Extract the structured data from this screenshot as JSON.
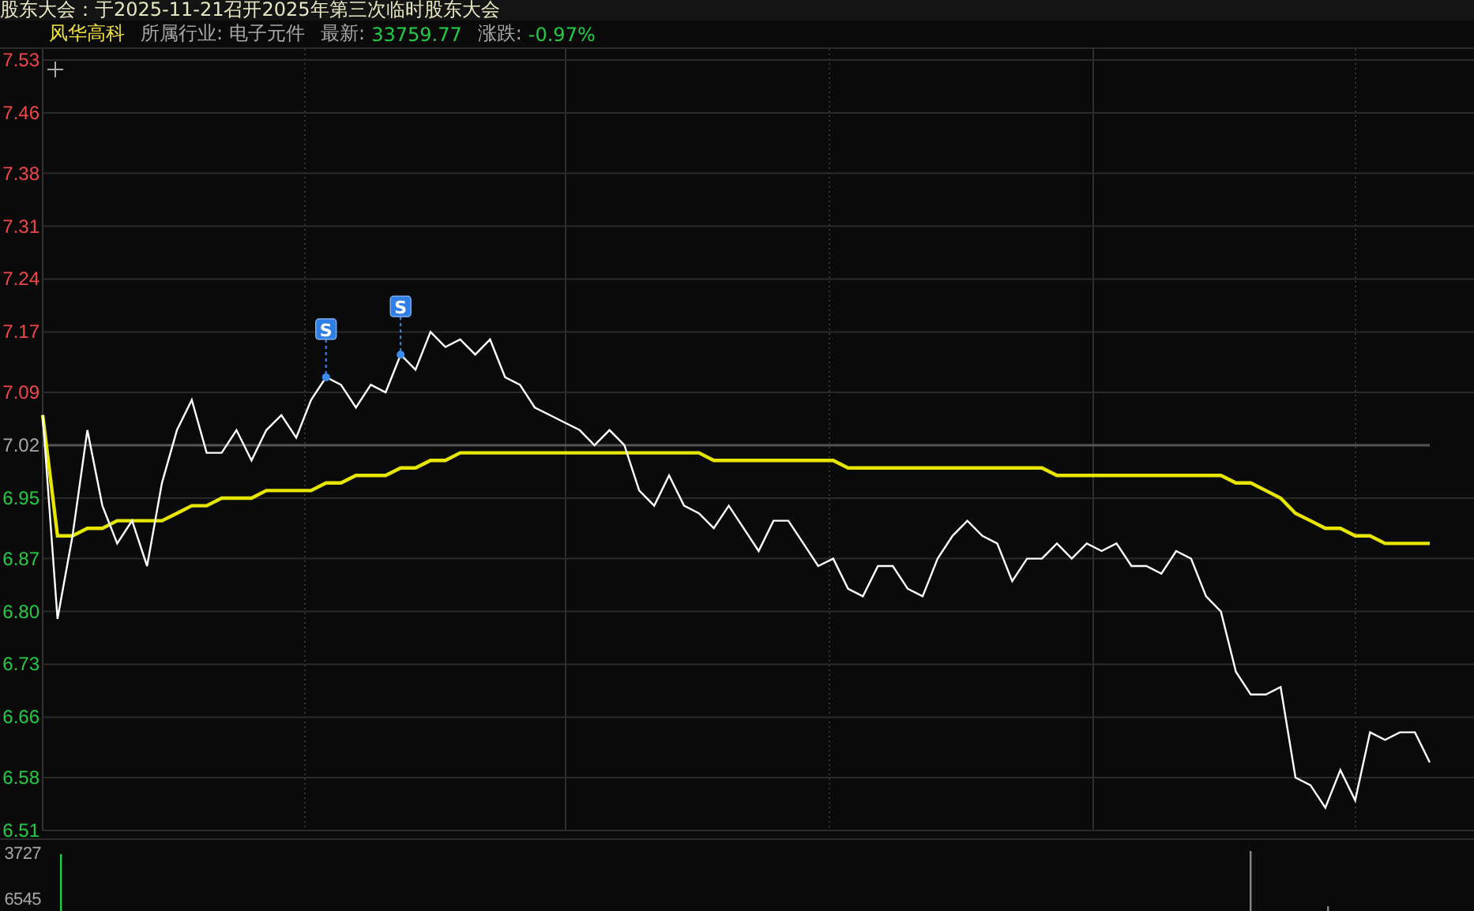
{
  "notice": "股东大会：于2025-11-21召开2025年第三次临时股东大会",
  "info_bar": {
    "name": "风华高科",
    "industry_label": "所属行业:",
    "industry": "电子元件",
    "latest_label": "最新:",
    "latest": "33759.77",
    "change_label": "涨跌:",
    "change": "-0.97%"
  },
  "price_chart": {
    "chart_data": {
      "type": "line",
      "grid": true,
      "ref_lines": [
        {
          "axis": "y",
          "value": 7.02,
          "color": "#555555"
        }
      ],
      "ylim": [
        6.51,
        7.53
      ],
      "yticks": [
        {
          "value": 7.53,
          "label": "7.53"
        },
        {
          "value": 7.46,
          "label": "7.46"
        },
        {
          "value": 7.38,
          "label": "7.38"
        },
        {
          "value": 7.31,
          "label": "7.31"
        },
        {
          "value": 7.24,
          "label": "7.24"
        },
        {
          "value": 7.17,
          "label": "7.17"
        },
        {
          "value": 7.09,
          "label": "7.09"
        },
        {
          "value": 7.02,
          "label": "7.02"
        },
        {
          "value": 6.95,
          "label": "6.95"
        },
        {
          "value": 6.87,
          "label": "6.87"
        },
        {
          "value": 6.8,
          "label": "6.80"
        },
        {
          "value": 6.73,
          "label": "6.73"
        },
        {
          "value": 6.66,
          "label": "6.66"
        },
        {
          "value": 6.58,
          "label": "6.58"
        },
        {
          "value": 6.51,
          "label": "6.51"
        }
      ],
      "categories": [
        null,
        null,
        null,
        null,
        null,
        null,
        null,
        null,
        null,
        null,
        null,
        null,
        null,
        null,
        null,
        null,
        null,
        null,
        null,
        null,
        null,
        null,
        null,
        null,
        null,
        null,
        null,
        null,
        null,
        null,
        null,
        null,
        null,
        null,
        null,
        null,
        null,
        null,
        null,
        null,
        null,
        null,
        null,
        null,
        null,
        null,
        null,
        null,
        null,
        null,
        null,
        null,
        null,
        null,
        null,
        null,
        null,
        null,
        null,
        null,
        null,
        null,
        null,
        null,
        null,
        null,
        null,
        null,
        null,
        null,
        null,
        null,
        null,
        null,
        null,
        null,
        null,
        null,
        null,
        null,
        null,
        null,
        null,
        null,
        null,
        null,
        null,
        null,
        null,
        null,
        null,
        null,
        null,
        null
      ],
      "series": [
        {
          "color": "#ffffff",
          "values": [
            7.06,
            6.79,
            6.9,
            7.04,
            6.94,
            6.89,
            6.92,
            6.86,
            6.97,
            7.04,
            7.08,
            7.01,
            7.01,
            7.04,
            7.0,
            7.04,
            7.06,
            7.03,
            7.08,
            7.11,
            7.1,
            7.07,
            7.1,
            7.09,
            7.14,
            7.12,
            7.17,
            7.15,
            7.16,
            7.14,
            7.16,
            7.11,
            7.1,
            7.07,
            7.06,
            7.05,
            7.04,
            7.02,
            7.04,
            7.02,
            6.96,
            6.94,
            6.98,
            6.94,
            6.93,
            6.91,
            6.94,
            6.91,
            6.88,
            6.92,
            6.92,
            6.89,
            6.86,
            6.87,
            6.83,
            6.82,
            6.86,
            6.86,
            6.83,
            6.82,
            6.87,
            6.9,
            6.92,
            6.9,
            6.89,
            6.84,
            6.87,
            6.87,
            6.89,
            6.87,
            6.89,
            6.88,
            6.89,
            6.86,
            6.86,
            6.85,
            6.88,
            6.87,
            6.82,
            6.8,
            6.72,
            6.69,
            6.69,
            6.7,
            6.58,
            6.57,
            6.54,
            6.59,
            6.55,
            6.64,
            6.63,
            6.64,
            6.64,
            6.6
          ]
        },
        {
          "color": "#e6e600",
          "values": [
            7.06,
            6.9,
            6.9,
            6.91,
            6.91,
            6.92,
            6.92,
            6.92,
            6.92,
            6.93,
            6.94,
            6.94,
            6.95,
            6.95,
            6.95,
            6.96,
            6.96,
            6.96,
            6.96,
            6.97,
            6.97,
            6.98,
            6.98,
            6.98,
            6.99,
            6.99,
            7.0,
            7.0,
            7.01,
            7.01,
            7.01,
            7.01,
            7.01,
            7.01,
            7.01,
            7.01,
            7.01,
            7.01,
            7.01,
            7.01,
            7.01,
            7.01,
            7.01,
            7.01,
            7.01,
            7.0,
            7.0,
            7.0,
            7.0,
            7.0,
            7.0,
            7.0,
            7.0,
            7.0,
            6.99,
            6.99,
            6.99,
            6.99,
            6.99,
            6.99,
            6.99,
            6.99,
            6.99,
            6.99,
            6.99,
            6.99,
            6.99,
            6.99,
            6.98,
            6.98,
            6.98,
            6.98,
            6.98,
            6.98,
            6.98,
            6.98,
            6.98,
            6.98,
            6.98,
            6.98,
            6.97,
            6.97,
            6.96,
            6.95,
            6.93,
            6.92,
            6.91,
            6.91,
            6.9,
            6.9,
            6.89,
            6.89,
            6.89,
            6.89
          ]
        }
      ],
      "annotations": [
        {
          "text": "S"
        },
        {
          "text": "S"
        }
      ]
    }
  },
  "volume_pane": {
    "axis_labels": [
      "3727",
      "6545"
    ]
  }
}
